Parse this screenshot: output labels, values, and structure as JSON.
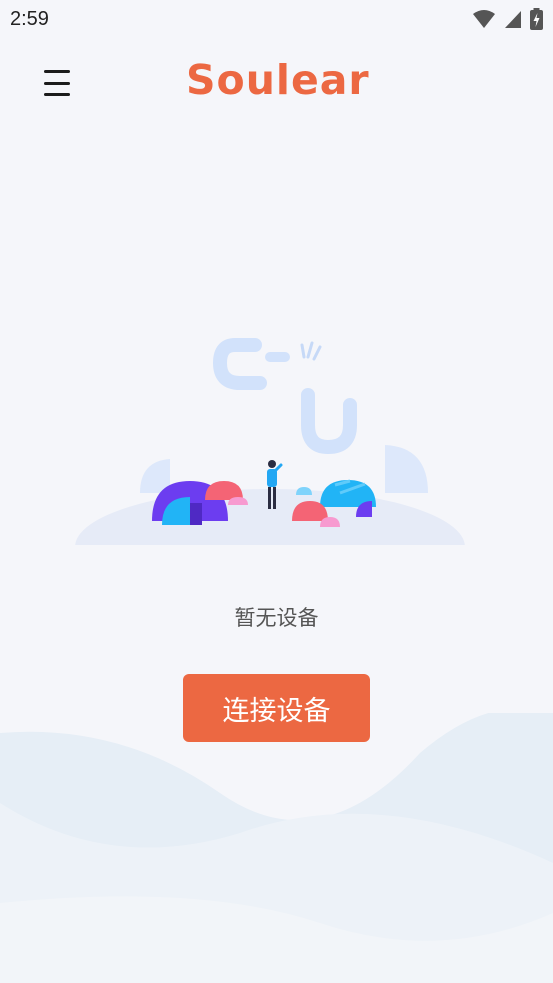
{
  "status_bar": {
    "time": "2:59",
    "icons": [
      "wifi-icon",
      "signal-icon",
      "battery-charging-icon"
    ]
  },
  "header": {
    "menu_icon": "hamburger-menu-icon",
    "logo": "Soulear"
  },
  "empty_state": {
    "illustration": "broken-link-illustration",
    "message": "暂无设备"
  },
  "actions": {
    "connect_label": "连接设备"
  },
  "colors": {
    "brand": "#ec6842",
    "background": "#f5f6fa"
  }
}
